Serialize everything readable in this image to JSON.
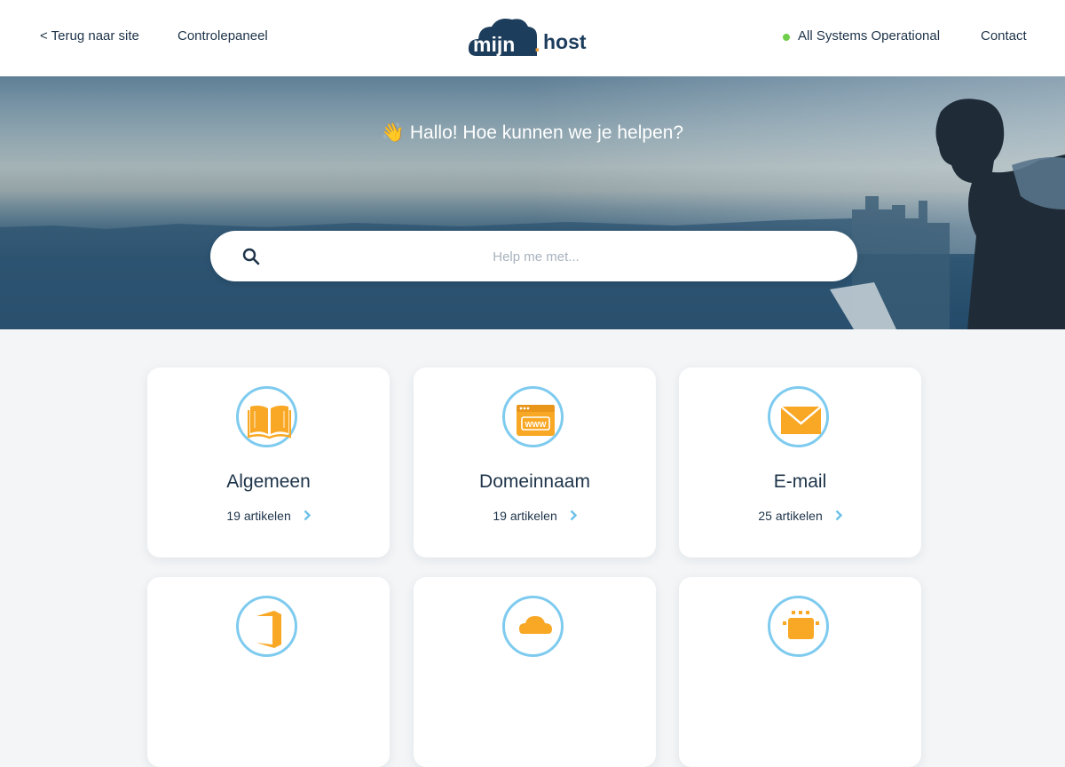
{
  "header": {
    "back_link": "< Terug naar site",
    "control_panel": "Controlepaneel",
    "logo": {
      "left": "mijn",
      "dot": ".",
      "right": "host"
    },
    "status_text": "All Systems Operational",
    "contact": "Contact"
  },
  "hero": {
    "greeting_emoji": "👋",
    "title": "Hallo! Hoe kunnen we je helpen?",
    "search_placeholder": "Help me met..."
  },
  "categories": [
    {
      "title": "Algemeen",
      "count": "19 artikelen",
      "icon": "open-book-icon"
    },
    {
      "title": "Domeinnaam",
      "count": "19 artikelen",
      "icon": "www-browser-icon"
    },
    {
      "title": "E-mail",
      "count": "25 artikelen",
      "icon": "envelope-icon"
    },
    {
      "title": "",
      "count": "",
      "icon": "office-icon"
    },
    {
      "title": "",
      "count": "",
      "icon": "cloud-icon"
    },
    {
      "title": "",
      "count": "",
      "icon": "server-icon"
    }
  ],
  "colors": {
    "accent_orange": "#f9a825",
    "ring_blue": "#7ecbef",
    "status_green": "#6fcf4a",
    "navy": "#1d3349"
  }
}
